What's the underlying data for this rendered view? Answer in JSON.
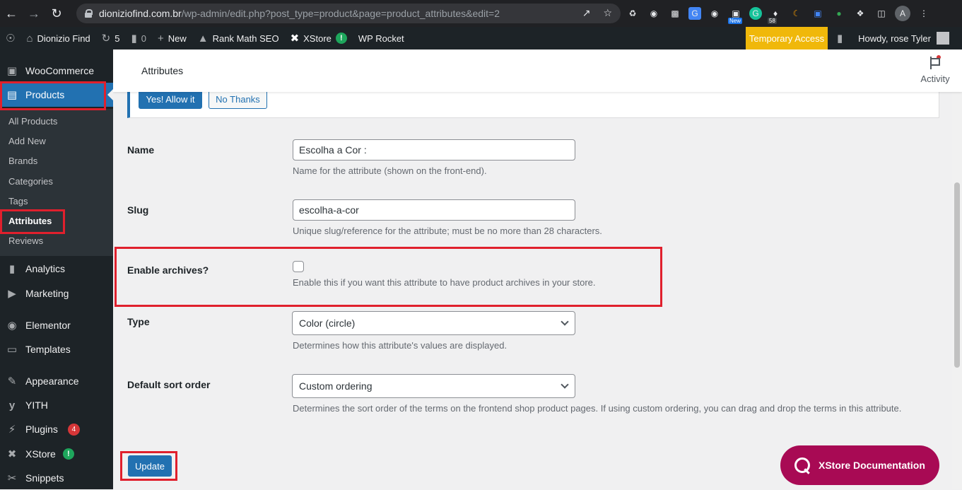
{
  "browser": {
    "url_host": "dioniziofind.com.br",
    "url_path": "/wp-admin/edit.php?post_type=product&page=product_attributes&edit=2",
    "ext_new_label": "New",
    "ext_count": "58",
    "profile_initial": "A"
  },
  "adminbar": {
    "site_name": "Dionizio Find",
    "updates_count": "5",
    "comments_count": "0",
    "new_label": "New",
    "rank_math": "Rank Math SEO",
    "xstore": "XStore",
    "wp_rocket": "WP Rocket",
    "temp_access": "Temporary Access",
    "howdy": "Howdy, rose Tyler"
  },
  "sidebar": {
    "woocommerce": "WooCommerce",
    "products": "Products",
    "submenu": [
      "All Products",
      "Add New",
      "Brands",
      "Categories",
      "Tags",
      "Attributes",
      "Reviews"
    ],
    "analytics": "Analytics",
    "marketing": "Marketing",
    "elementor": "Elementor",
    "templates": "Templates",
    "appearance": "Appearance",
    "yith": "YITH",
    "plugins": "Plugins",
    "plugins_count": "4",
    "xstore": "XStore",
    "snippets": "Snippets"
  },
  "header": {
    "title": "Attributes",
    "activity": "Activity"
  },
  "notice": {
    "allow_label": "Yes! Allow it",
    "decline_label": "No Thanks"
  },
  "form": {
    "name_label": "Name",
    "name_value": "Escolha a Cor :",
    "name_desc": "Name for the attribute (shown on the front-end).",
    "slug_label": "Slug",
    "slug_value": "escolha-a-cor",
    "slug_desc": "Unique slug/reference for the attribute; must be no more than 28 characters.",
    "archives_label": "Enable archives?",
    "archives_checked": false,
    "archives_desc": "Enable this if you want this attribute to have product archives in your store.",
    "type_label": "Type",
    "type_value": "Color (circle)",
    "type_desc": "Determines how this attribute's values are displayed.",
    "sort_label": "Default sort order",
    "sort_value": "Custom ordering",
    "sort_desc": "Determines the sort order of the terms on the frontend shop product pages. If using custom ordering, you can drag and drop the terms in this attribute.",
    "update_label": "Update"
  },
  "xstore_doc": "XStore Documentation",
  "colors": {
    "wp_blue": "#2271b1",
    "admin_dark": "#1d2327",
    "temp_access": "#f0b80a",
    "xstore_doc": "#a80a54",
    "highlight_red": "#e0202d"
  }
}
